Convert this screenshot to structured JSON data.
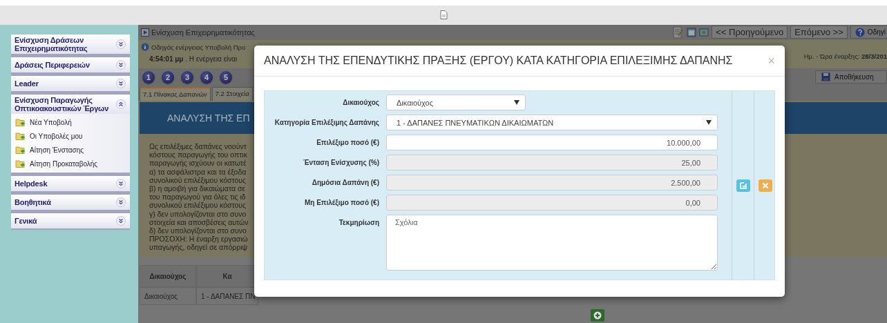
{
  "sidebar": {
    "sections": [
      {
        "title": "Ενίσχυση Δράσεων Επιχειρηματικότητας",
        "expanded": false
      },
      {
        "title": "Δράσεις Περιφερειών",
        "expanded": false
      },
      {
        "title": "Leader",
        "expanded": false
      },
      {
        "title": "Ενίσχυση Παραγωγής Οπτικοακουστικών Έργων",
        "expanded": true,
        "items": [
          "Νέα Υποβολή",
          "Οι Υποβολές μου",
          "Αίτηση Ένστασης",
          "Αίτηση Προκαταβολής"
        ]
      },
      {
        "title": "Helpdesk",
        "expanded": false
      },
      {
        "title": "Βοηθητικά",
        "expanded": false
      },
      {
        "title": "Γενικά",
        "expanded": false
      }
    ]
  },
  "main": {
    "header_title": "Ενίσχυση Επιχειρηματικότητας",
    "nav_buttons": [
      "<< Προηγούμενο",
      "Επόμενο >>"
    ],
    "help_button": "Οδηγί",
    "info_line_1": "Οδηγός ενέργειας Υποβολή Προ",
    "info_line_2": "**4:54:01 μμ** . Η ενέργεια είναι",
    "start_time": "Ημ. - Ώρα έναρξης: **28/3/201**",
    "steps": [
      "1",
      "2",
      "3",
      "4",
      "5"
    ],
    "save_button": "Αποθήκευση",
    "tabs": [
      {
        "label": "7.1 Πίνακας Δαπανών",
        "selected": true
      },
      {
        "label": "7.2 Στοιχεία",
        "selected": false
      }
    ],
    "banner": "ΑΝΑΛΥΣΗ ΤΗΣ ΕΠ",
    "paragraph_lines": [
      "Ως επιλέξιμες δαπάνες νοούντ",
      "κόστους παραγωγής του οπτικ",
      "παραγωγής ισχύουν οι κατωτέ",
      "α) τα ασφάλιστρα και τα έξοδα",
      "συνολικού επιλέξιμου κόστους",
      "β) η αμοιβή για δικαιώματα σε",
      "του παραγωγού για όλες τις ιδ",
      "συνολικού επιλέξιμου κόστους",
      "γ) δεν υπολογίζονται στο συνο",
      "στοιχεία και αποσβέσεις αυτών",
      "δ) δεν υπολογίζονται στο συνο",
      "ΠΡΟΣΟΧΗ: Η έναρξη εργασιώ",
      "υπαγωγής, οδηγεί σε απόρριψ"
    ],
    "table": {
      "columns": [
        "Δικαιούχος",
        "Κα"
      ],
      "rows": [
        [
          "Δικαιούχος",
          "1 - ΔΑΠΑΝΕΣ ΠΝ"
        ]
      ]
    }
  },
  "modal": {
    "title": "ΑΝΑΛΥΣΗ ΤΗΣ ΕΠΕΝΔΥΤΙΚΗΣ ΠΡΑΞΗΣ (ΕΡΓΟΥ) ΚΑΤΑ ΚΑΤΗΓΟΡΙΑ ΕΠΙΛΕΞΙΜΗΣ ΔΑΠΑΝΗΣ",
    "close": "×",
    "fields": [
      {
        "kind": "select",
        "label": "Δικαιούχος",
        "value": "Δικαιούχος"
      },
      {
        "kind": "select",
        "label": "Κατηγορία Επιλέξιμης Δαπάνης",
        "value": "1 - ΔΑΠΑΝΕΣ ΠΝΕΥΜΑΤΙΚΩΝ ΔΙΚΑΙΩΜΑΤΩΝ"
      },
      {
        "kind": "text",
        "label": "Επιλέξιμο ποσό (€)",
        "value": "10.000,00"
      },
      {
        "kind": "readonly",
        "label": "Ένταση Ενίσχυσης (%)",
        "value": "25,00"
      },
      {
        "kind": "readonly",
        "label": "Δημόσια Δαπάνη (€)",
        "value": "2.500,00"
      },
      {
        "kind": "readonly",
        "label": "Μη Επιλέξιμο ποσό (€)",
        "value": "0,00"
      },
      {
        "kind": "textarea",
        "label": "Τεκμηρίωση",
        "placeholder": "Σχόλια"
      }
    ]
  }
}
